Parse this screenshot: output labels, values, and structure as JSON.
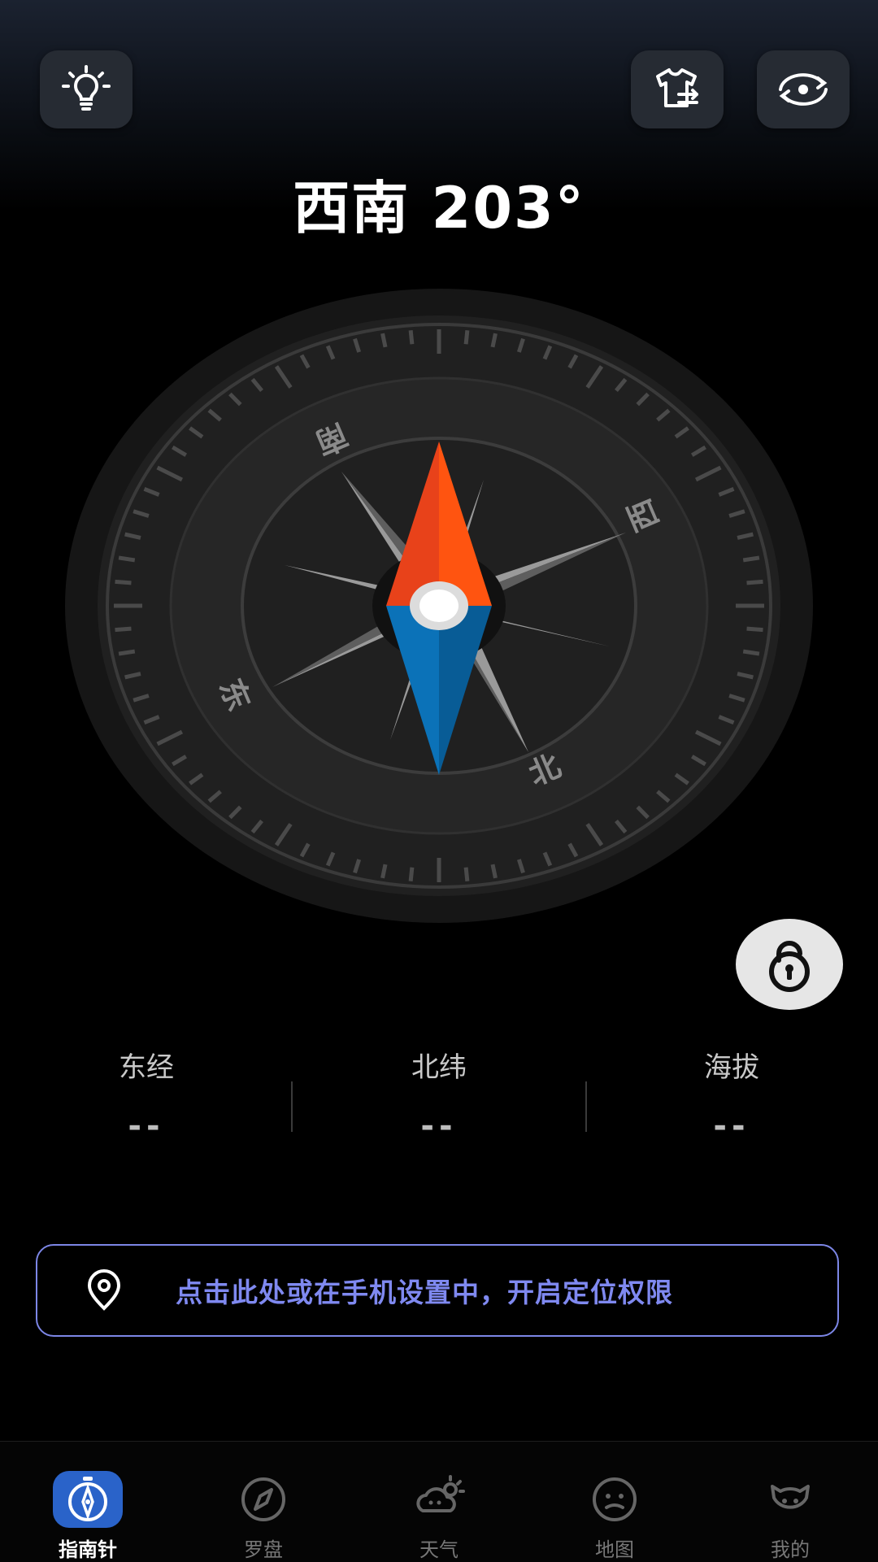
{
  "heading": {
    "direction": "西南",
    "degrees": "203°"
  },
  "compass": {
    "labels": {
      "south": "南",
      "west": "西",
      "east": "东",
      "north": "北"
    }
  },
  "coords": [
    {
      "label": "东经",
      "value": "--"
    },
    {
      "label": "北纬",
      "value": "--"
    },
    {
      "label": "海拔",
      "value": "--"
    }
  ],
  "permission_banner": {
    "text": "点击此处或在手机设置中，开启定位权限"
  },
  "tabs": [
    {
      "label": "指南针",
      "icon": "compass-tab-icon",
      "active": true
    },
    {
      "label": "罗盘",
      "icon": "dial-icon",
      "active": false
    },
    {
      "label": "天气",
      "icon": "weather-icon",
      "active": false
    },
    {
      "label": "地图",
      "icon": "map-icon",
      "active": false
    },
    {
      "label": "我的",
      "icon": "profile-icon",
      "active": false
    }
  ],
  "colors": {
    "accent": "#7f89f0",
    "needle_north": "#ff4a0f",
    "needle_south": "#0a6fb4"
  }
}
